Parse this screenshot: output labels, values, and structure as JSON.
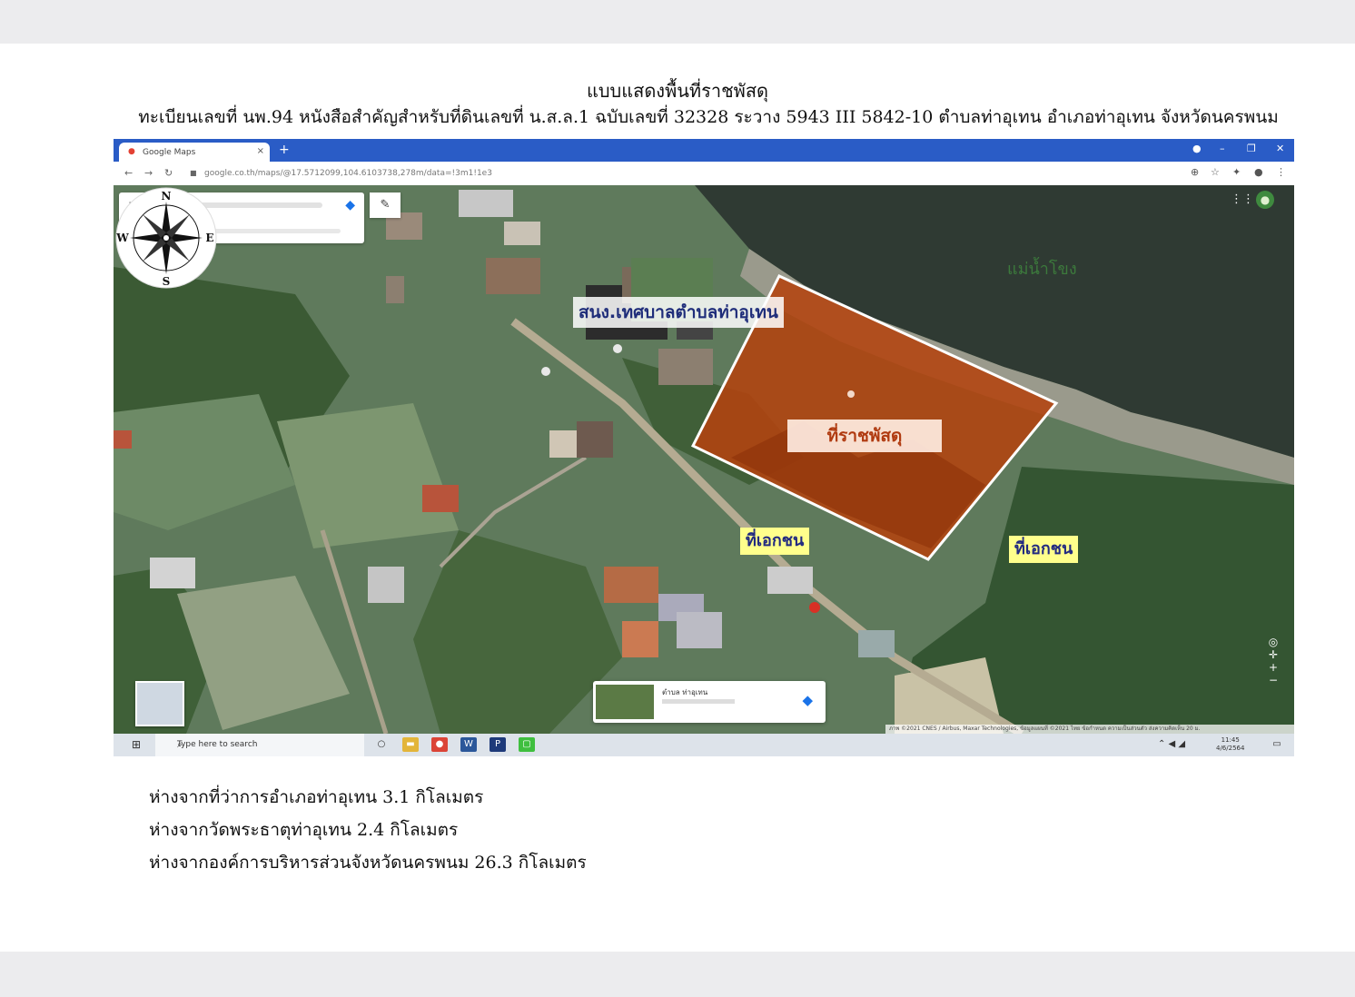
{
  "document": {
    "title": "แบบแสดงพื้นที่ราชพัสดุ",
    "subtitle": "ทะเบียนเลขที่ นพ.94 หนังสือสำคัญสำหรับที่ดินเลขที่ น.ส.ล.1 ฉบับเลขที่ 32328 ระวาง 5943 III 5842-10 ตำบลท่าอุเทน อำเภอท่าอุเทน จังหวัดนครพนม"
  },
  "browser": {
    "tab_title": "Google Maps",
    "tab_close": "×",
    "new_tab": "+",
    "url": "google.co.th/maps/@17.5712099,104.6103738,278m/data=!3m1!1e3",
    "window_buttons": [
      "●",
      "–",
      "❐",
      "✕"
    ]
  },
  "map": {
    "compass": {
      "n": "N",
      "s": "S",
      "e": "E",
      "w": "W"
    },
    "river_label": "แม่น้ำโขง",
    "office_label": "สนง.เทศบาลตำบลท่าอุเทน",
    "state_land_label": "ที่ราชพัสดุ",
    "private_label_left": "ที่เอกชน",
    "private_label_right": "ที่เอกชน",
    "poi_card_title": "ตำบล ท่าอุเทน",
    "footer": "ภาพ ©2021 CNES / Airbus, Maxar Technologies, ข้อมูลแผนที่ ©2021   ไทย   ข้อกำหนด   ความเป็นส่วนตัว   ส่งความคิดเห็น   20 ม."
  },
  "taskbar": {
    "search_placeholder": "Type here to search",
    "time": "11:45",
    "date": "4/6/2564"
  },
  "distances": [
    "ห่างจากที่ว่าการอำเภอท่าอุเทน 3.1 กิโลเมตร",
    "ห่างจากวัดพระธาตุท่าอุเทน 2.4 กิโลเมตร",
    "ห่างจากองค์การบริหารส่วนจังหวัดนครพนม 26.3 กิโลเมตร"
  ],
  "colors": {
    "state_land_fill": "#b3430f",
    "river": "#2f3a33",
    "private_label_bg": "#ffff8c",
    "office_label_text": "#1f2d7a"
  },
  "icons": [
    "map-pin-icon",
    "hamburger-menu-icon",
    "directions-icon",
    "pen-icon",
    "apps-grid-icon",
    "account-icon",
    "compass-rose-icon",
    "windows-start-icon",
    "search-icon"
  ]
}
